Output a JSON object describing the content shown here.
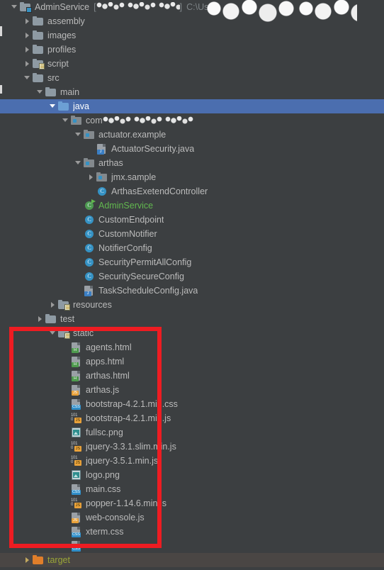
{
  "window": {
    "background_color": "#3c3f41",
    "selection_color": "#4b6eaf",
    "annotation_color": "#ee1c22",
    "hover_color": "#4a4644"
  },
  "header": {
    "project_name": "AdminService",
    "bracket_open": "[",
    "redacted_module": "",
    "bracket_close": "]",
    "path_prefix": "C:\\Use"
  },
  "tree": {
    "rows": [
      {
        "depth": 0,
        "twisty": "expanded",
        "icon": "folder-module",
        "label": "AdminService",
        "state": "normal"
      },
      {
        "depth": 1,
        "twisty": "collapsed",
        "icon": "folder",
        "label": "assembly",
        "state": "normal"
      },
      {
        "depth": 1,
        "twisty": "collapsed",
        "icon": "folder",
        "label": "images",
        "state": "normal"
      },
      {
        "depth": 1,
        "twisty": "collapsed",
        "icon": "folder",
        "label": "profiles",
        "state": "normal"
      },
      {
        "depth": 1,
        "twisty": "collapsed",
        "icon": "folder-res",
        "label": "script",
        "state": "normal"
      },
      {
        "depth": 1,
        "twisty": "expanded",
        "icon": "folder",
        "label": "src",
        "state": "normal"
      },
      {
        "depth": 2,
        "twisty": "expanded",
        "icon": "folder",
        "label": "main",
        "state": "normal"
      },
      {
        "depth": 3,
        "twisty": "expanded",
        "icon": "folder-blue",
        "label": "java",
        "state": "selected"
      },
      {
        "depth": 4,
        "twisty": "expanded",
        "icon": "package",
        "label": "com",
        "state": "redacted"
      },
      {
        "depth": 5,
        "twisty": "expanded",
        "icon": "package",
        "label": "actuator.example",
        "state": "normal"
      },
      {
        "depth": 6,
        "twisty": "none",
        "icon": "file-java",
        "label": "ActuatorSecurity.java",
        "state": "normal"
      },
      {
        "depth": 5,
        "twisty": "expanded",
        "icon": "package",
        "label": "arthas",
        "state": "normal"
      },
      {
        "depth": 6,
        "twisty": "collapsed",
        "icon": "package",
        "label": "jmx.sample",
        "state": "normal"
      },
      {
        "depth": 6,
        "twisty": "none",
        "icon": "class",
        "label": "ArthasExetendController",
        "state": "normal"
      },
      {
        "depth": 5,
        "twisty": "none",
        "icon": "class-run",
        "label": "AdminService",
        "state": "runnable"
      },
      {
        "depth": 5,
        "twisty": "none",
        "icon": "class",
        "label": "CustomEndpoint",
        "state": "normal"
      },
      {
        "depth": 5,
        "twisty": "none",
        "icon": "class",
        "label": "CustomNotifier",
        "state": "normal"
      },
      {
        "depth": 5,
        "twisty": "none",
        "icon": "class",
        "label": "NotifierConfig",
        "state": "normal"
      },
      {
        "depth": 5,
        "twisty": "none",
        "icon": "class",
        "label": "SecurityPermitAllConfig",
        "state": "normal"
      },
      {
        "depth": 5,
        "twisty": "none",
        "icon": "class",
        "label": "SecuritySecureConfig",
        "state": "normal"
      },
      {
        "depth": 5,
        "twisty": "none",
        "icon": "file-java",
        "label": "TaskScheduleConfig.java",
        "state": "normal"
      },
      {
        "depth": 3,
        "twisty": "collapsed",
        "icon": "folder-res",
        "label": "resources",
        "state": "normal"
      },
      {
        "depth": 2,
        "twisty": "collapsed",
        "icon": "folder",
        "label": "test",
        "state": "normal"
      },
      {
        "depth": 3,
        "twisty": "expanded",
        "icon": "folder-res",
        "label": "static",
        "state": "normal"
      },
      {
        "depth": 4,
        "twisty": "none",
        "icon": "file-html",
        "label": "agents.html",
        "state": "normal"
      },
      {
        "depth": 4,
        "twisty": "none",
        "icon": "file-html",
        "label": "apps.html",
        "state": "normal"
      },
      {
        "depth": 4,
        "twisty": "none",
        "icon": "file-html",
        "label": "arthas.html",
        "state": "normal"
      },
      {
        "depth": 4,
        "twisty": "none",
        "icon": "file-js",
        "label": "arthas.js",
        "state": "normal"
      },
      {
        "depth": 4,
        "twisty": "none",
        "icon": "file-css",
        "label": "bootstrap-4.2.1.min.css",
        "state": "normal"
      },
      {
        "depth": 4,
        "twisty": "none",
        "icon": "file-minjs",
        "label": "bootstrap-4.2.1.min.js",
        "state": "normal"
      },
      {
        "depth": 4,
        "twisty": "none",
        "icon": "file-image",
        "label": "fullsc.png",
        "state": "normal"
      },
      {
        "depth": 4,
        "twisty": "none",
        "icon": "file-minjs",
        "label": "jquery-3.3.1.slim.min.js",
        "state": "normal"
      },
      {
        "depth": 4,
        "twisty": "none",
        "icon": "file-minjs",
        "label": "jquery-3.5.1.min.js",
        "state": "normal"
      },
      {
        "depth": 4,
        "twisty": "none",
        "icon": "file-image",
        "label": "logo.png",
        "state": "normal"
      },
      {
        "depth": 4,
        "twisty": "none",
        "icon": "file-css",
        "label": "main.css",
        "state": "normal"
      },
      {
        "depth": 4,
        "twisty": "none",
        "icon": "file-minjs",
        "label": "popper-1.14.6.min.js",
        "state": "normal"
      },
      {
        "depth": 4,
        "twisty": "none",
        "icon": "file-js",
        "label": "web-console.js",
        "state": "normal"
      },
      {
        "depth": 4,
        "twisty": "none",
        "icon": "file-css",
        "label": "xterm.css",
        "state": "normal"
      },
      {
        "depth": 4,
        "twisty": "none",
        "icon": "file-css",
        "label": "",
        "state": "clipped"
      },
      {
        "depth": 1,
        "twisty": "collapsed",
        "icon": "folder-orange",
        "label": "target",
        "state": "hovered"
      }
    ]
  },
  "annotation": {
    "shape": "rectangle",
    "color": "#ee1c22",
    "encloses": "static folder and its files"
  }
}
